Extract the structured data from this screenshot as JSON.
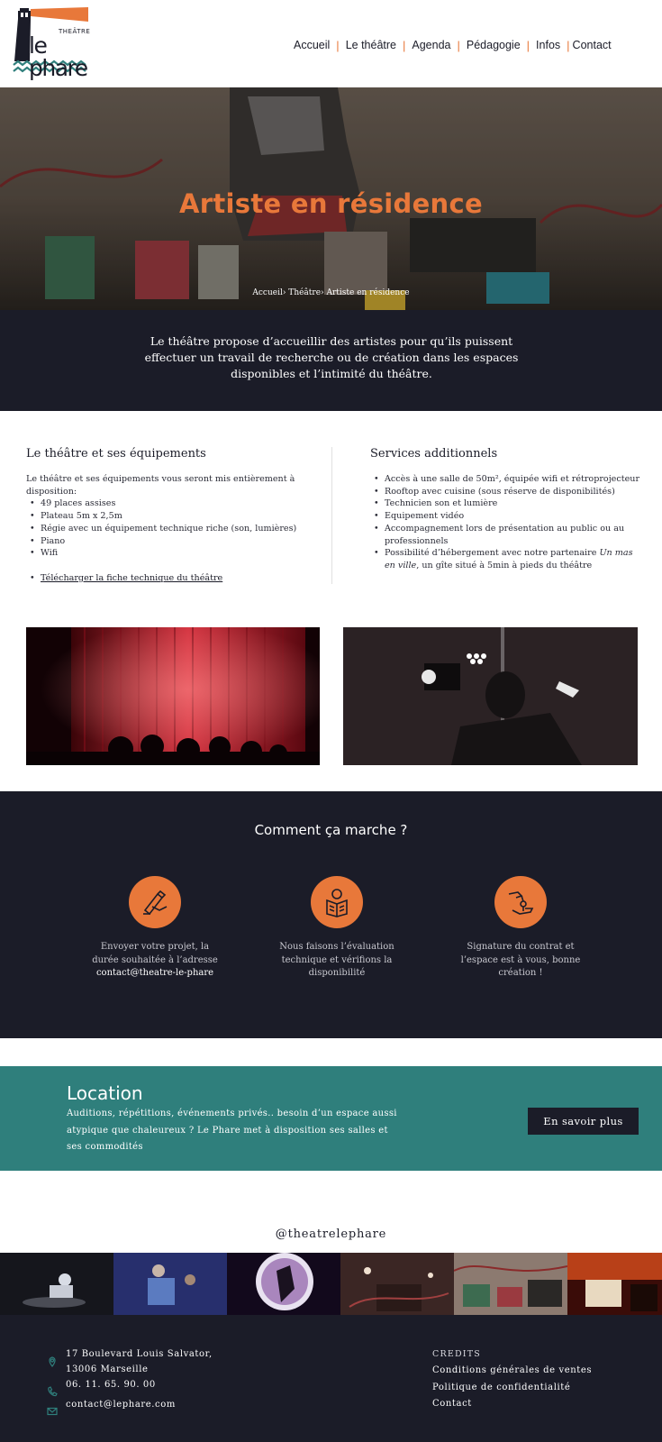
{
  "header": {
    "logo": {
      "small": "THEÂTRE",
      "name": "le phare"
    },
    "nav": [
      "Accueil",
      "Le théâtre",
      "Agenda",
      "Pédagogie",
      "Infos",
      "Contact"
    ]
  },
  "hero": {
    "title": "Artiste en résidence",
    "breadcrumb": "Accueil› Théâtre› Artiste en résidence"
  },
  "intro": {
    "text": "Le théâtre propose d’accueillir des artistes pour qu’ils puissent effectuer un travail de recherche ou de création dans les espaces disponibles et l’intimité du théâtre."
  },
  "equipment": {
    "heading": "Le théâtre et ses équipements",
    "lead": "Le théâtre et ses équipements vous seront mis entièrement à disposition:",
    "items": [
      "49 places assises",
      "Plateau 5m x 2,5m",
      "Régie avec un équipement technique riche (son, lumières)",
      "Piano",
      "Wifi"
    ],
    "download": "Télécharger la fiche technique du théâtre"
  },
  "services": {
    "heading": "Services additionnels",
    "items": [
      "Accès à une salle de 50m², équipée wifi et rétroprojecteur",
      "Rooftop avec cuisine  (sous réserve de disponibilités)",
      "Technicien son et lumière",
      "Equipement vidéo",
      "Accompagnement lors de présentation au public ou au professionnels"
    ],
    "last_prefix": "Possibilité d’hébergement avec notre partenaire ",
    "last_partner": "Un mas en ville",
    "last_suffix": ", un gîte situé à 5min à pieds du théâtre"
  },
  "how": {
    "title": "Comment ça marche ?",
    "steps": [
      {
        "icon": "hand-writing-icon",
        "text": "Envoyer votre projet, la durée souhaitée à l’adresse",
        "email": "contact@theatre-le-phare"
      },
      {
        "icon": "person-reading-icon",
        "text": "Nous faisons l’évaluation technique et vérifions la disponibilité"
      },
      {
        "icon": "handshake-key-icon",
        "text": "Signature du contrat et l’espace est à vous, bonne création !"
      }
    ]
  },
  "location": {
    "title": "Location",
    "text": "Auditions, répétitions, événements privés.. besoin d’un espace aussi atypique que chaleureux ? Le Phare met à disposition ses salles et ses commodités",
    "button": "En savoir plus"
  },
  "instagram": {
    "handle": "@theatrelephare"
  },
  "footer": {
    "address": "17 Boulevard Louis Salvator, 13006 Marseille",
    "phone": "06. 11. 65. 90. 00",
    "email": "contact@lephare.com",
    "credits_heading": "CREDITS",
    "links": [
      "Conditions générales de ventes",
      "Politique de confidentialité",
      "Contact"
    ]
  },
  "colors": {
    "accent": "#e8783a",
    "dark": "#1b1c28",
    "teal": "#2f7f7c"
  }
}
